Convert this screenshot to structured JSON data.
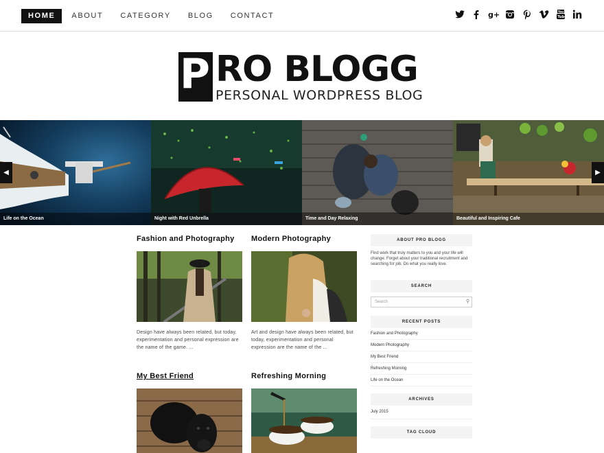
{
  "nav": {
    "items": [
      {
        "label": "HOME",
        "active": true
      },
      {
        "label": "ABOUT"
      },
      {
        "label": "CATEGORY"
      },
      {
        "label": "BLOG"
      },
      {
        "label": "CONTACT"
      }
    ]
  },
  "social": [
    "twitter-icon",
    "facebook-icon",
    "google-plus-icon",
    "instagram-icon",
    "pinterest-icon",
    "vimeo-icon",
    "youtube-icon",
    "linkedin-icon"
  ],
  "logo": {
    "letter": "P",
    "rest": "RO BLOGG",
    "tagline": "PERSONAL WORDPRESS BLOG"
  },
  "slider": {
    "slides": [
      {
        "caption": "Life on the Ocean"
      },
      {
        "caption": "Night with Red Unbrella"
      },
      {
        "caption": "Time and Day Relaxing"
      },
      {
        "caption": "Beautiful and Inspiring Cafe"
      }
    ]
  },
  "posts": [
    {
      "title": "Fashion and Photography",
      "excerpt": "Design have always been related, but today, experimentation and personal expression are the name of the game. ..."
    },
    {
      "title": "Modern Photography",
      "excerpt": "Art and design have always been related, but today, experimentation and personal expression are the name of the ..."
    },
    {
      "title": "My Best Friend"
    },
    {
      "title": "Refreshing Morning"
    }
  ],
  "sidebar": {
    "about_title": "ABOUT PRO BLOGG",
    "about_text": "Find work that truly matters to you and your life will change. Forget about your traditional recruitment and searching for job. Do what you really love.",
    "search_title": "SEARCH",
    "search_placeholder": "Search",
    "recent_title": "RECENT POSTS",
    "recent": [
      "Fashion and Photography",
      "Modern Photography",
      "My Best Friend",
      "Refreshing Morning",
      "Life on the Ocean"
    ],
    "archives_title": "ARCHIVES",
    "archives": [
      "July 2015"
    ],
    "tagcloud_title": "TAG CLOUD"
  }
}
